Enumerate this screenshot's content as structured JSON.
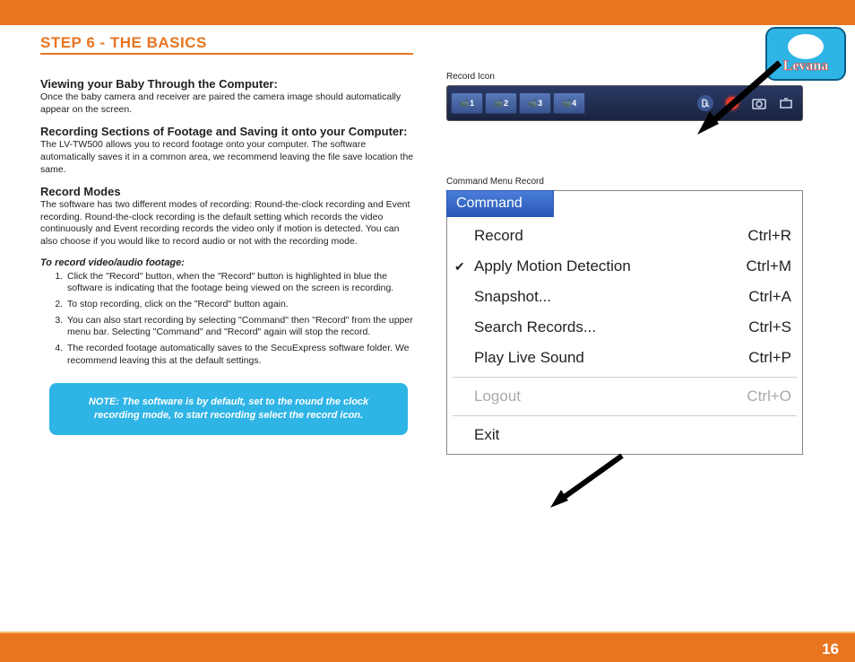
{
  "header": {
    "step_title": "STEP 6   - THE BASICS",
    "logo_text": "Levana"
  },
  "left": {
    "h1": "Viewing your Baby Through the Computer:",
    "p1": "Once the baby camera and receiver are paired the camera image should automatically appear on the screen.",
    "h2": "Recording Sections of Footage and Saving it onto your Computer:",
    "p2": "The LV-TW500 allows you to record footage onto your computer. The software automatically saves it in a common area, we recommend leaving the file save location the same.",
    "h3": "Record Modes",
    "p3": "The software has two different modes of recording: Round-the-clock recording and Event recording. Round-the-clock recording is the default setting which records the video continuously and Event recording records the video only if motion is detected. You can also choose if you would like to record audio or not with the recording mode.",
    "sub": "To record video/audio footage:",
    "steps": [
      "Click the \"Record\" button, when the \"Record\" button is highlighted in blue the software is indicating that the footage being viewed on the screen is recording.",
      "To stop recording, click on the \"Record\" button again.",
      "You can also start recording by selecting \"Command\"  then \"Record\" from the upper menu bar. Selecting \"Command\" and \"Record\" again will stop the record.",
      "The recorded footage automatically saves to the SecuExpress software folder. We recommend leaving this at the default settings."
    ],
    "note": "NOTE: The software is by default, set to the round the clock recording mode, to start recording select the record icon."
  },
  "right": {
    "cap1": "Record Icon",
    "toolbar": {
      "cams": [
        "1",
        "2",
        "3",
        "4"
      ]
    },
    "cap2": "Command Menu Record",
    "menu": {
      "title": "Command",
      "items": [
        {
          "label": "Record",
          "shortcut": "Ctrl+R",
          "checked": false,
          "disabled": false
        },
        {
          "label": "Apply Motion Detection",
          "shortcut": "Ctrl+M",
          "checked": true,
          "disabled": false
        },
        {
          "label": "Snapshot...",
          "shortcut": "Ctrl+A",
          "checked": false,
          "disabled": false
        },
        {
          "label": "Search Records...",
          "shortcut": "Ctrl+S",
          "checked": false,
          "disabled": false
        },
        {
          "label": "Play Live Sound",
          "shortcut": "Ctrl+P",
          "checked": false,
          "disabled": false
        }
      ],
      "logout": {
        "label": "Logout",
        "shortcut": "Ctrl+O"
      },
      "exit": {
        "label": "Exit",
        "shortcut": ""
      }
    }
  },
  "page_number": "16"
}
